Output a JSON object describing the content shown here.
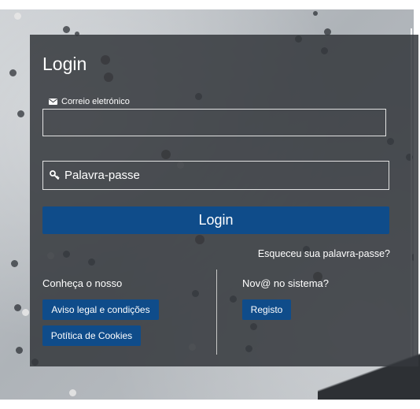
{
  "form": {
    "title": "Login",
    "email_label": "Correio eletrónico",
    "email_value": "",
    "password_placeholder": "Palavra-passe",
    "login_button": "Login",
    "forgot_password": "Esqueceu sua palavra-passe?"
  },
  "footer": {
    "know_label": "Conheça o nosso",
    "legal_button": "Aviso legal e condições",
    "cookies_button": "Potítica de Cookies",
    "new_label": "Nov@ no sistema?",
    "register_button": "Registo"
  },
  "icons": {
    "email": "envelope-icon",
    "password": "key-icon"
  },
  "colors": {
    "primary_button": "#0f4c8a",
    "panel": "#34383c",
    "text": "#ffffff"
  }
}
